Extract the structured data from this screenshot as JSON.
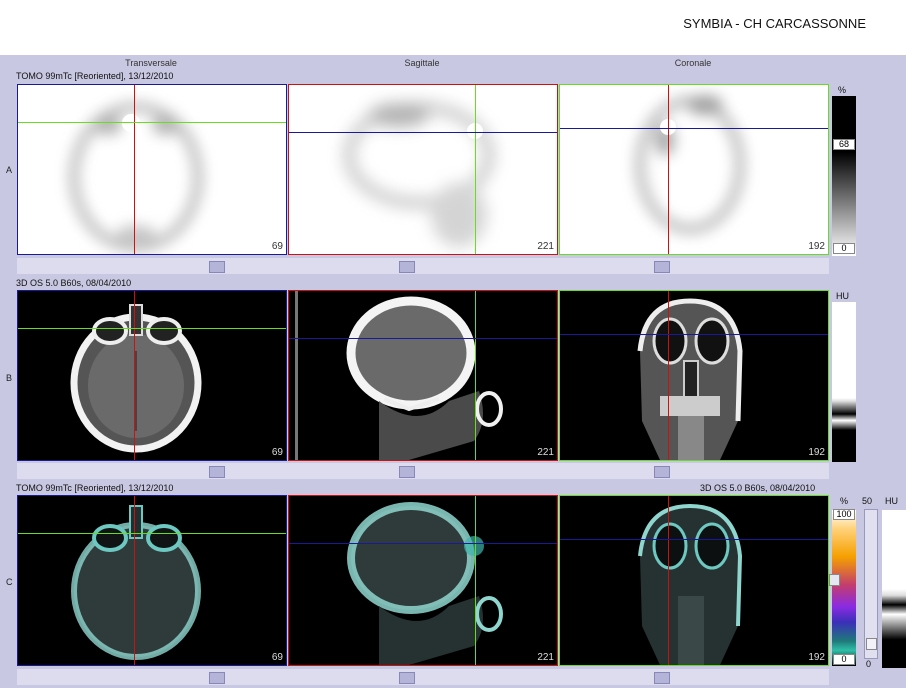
{
  "header": {
    "site_title": "SYMBIA - CH CARCASSONNE"
  },
  "columns": {
    "transversal": "Transversale",
    "sagittal": "Sagittale",
    "coronal": "Coronale"
  },
  "rows": {
    "a": {
      "letter": "A",
      "series": "TOMO 99mTc [Reoriented], 13/12/2010"
    },
    "b": {
      "letter": "B",
      "series": "3D  OS  5.0  B60s, 08/04/2010"
    },
    "c": {
      "letter": "C",
      "series_left": "TOMO 99mTc [Reoriented], 13/12/2010",
      "series_right": "3D  OS  5.0  B60s, 08/04/2010"
    }
  },
  "slices": {
    "transversal": "69",
    "sagittal": "221",
    "coronal": "192"
  },
  "colorbars": {
    "a": {
      "unit": "%",
      "level": "68",
      "min": "0"
    },
    "b": {
      "unit": "HU"
    },
    "c": {
      "unit_left": "%",
      "max": "100",
      "min": "0",
      "unit_right": "HU",
      "scale_top": "50",
      "scale_bottom": "0"
    }
  },
  "colors": {
    "crosshair_red": "#cc1111",
    "crosshair_green": "#66dd22",
    "crosshair_blue": "#1a1a99",
    "panel_bg": "#c8c8e2"
  }
}
